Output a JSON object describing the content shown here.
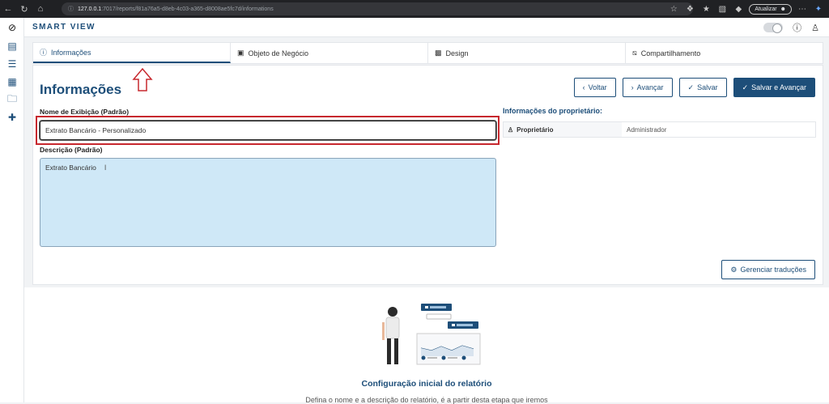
{
  "browser": {
    "url_host": "127.0.0.1",
    "url_rest": ":7017/reports/f81a76a5-d8eb-4c03-a365-d8008ae5fc7d/informations",
    "update_label": "Atualizar"
  },
  "app": {
    "title": "SMART VIEW"
  },
  "tabs": [
    {
      "label": "Informações",
      "icon": "info-icon"
    },
    {
      "label": "Objeto de Negócio",
      "icon": "briefcase-icon"
    },
    {
      "label": "Design",
      "icon": "image-icon"
    },
    {
      "label": "Compartilhamento",
      "icon": "share-icon"
    }
  ],
  "page": {
    "title": "Informações",
    "buttons": {
      "back": "Voltar",
      "next": "Avançar",
      "save": "Salvar",
      "save_next": "Salvar e Avançar"
    },
    "name_label": "Nome de Exibição (Padrão)",
    "name_value": "Extrato Bancário - Personalizado",
    "desc_label": "Descrição (Padrão)",
    "desc_value": "Extrato Bancário",
    "owner_title": "Informações do proprietário:",
    "owner_key": "Proprietário",
    "owner_value": "Administrador",
    "translations_button": "Gerenciar traduções"
  },
  "illustration": {
    "title": "Configuração inicial do relatório",
    "description": "Defina o nome e a descrição do relatório, é a partir desta etapa que iremos"
  },
  "colors": {
    "brand": "#1d4e79",
    "highlight_red": "#c7282e",
    "textarea_bg": "#cfe8f7"
  }
}
